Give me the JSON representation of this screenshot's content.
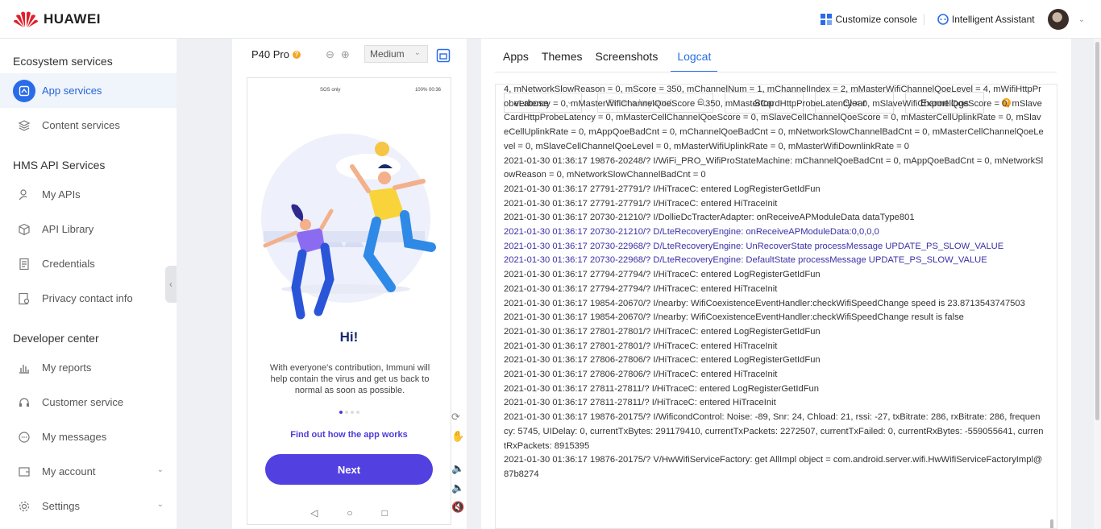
{
  "topbar": {
    "brand": "HUAWEI",
    "customize": "Customize console",
    "assistant": "Intelligent Assistant"
  },
  "sidebar": {
    "groups": [
      {
        "title": "Ecosystem services",
        "items": [
          {
            "label": "App services",
            "icon": "app-services-icon",
            "active": true
          },
          {
            "label": "Content services",
            "icon": "layers-icon"
          }
        ]
      },
      {
        "title": "HMS API Services",
        "items": [
          {
            "label": "My APIs",
            "icon": "api-user-icon"
          },
          {
            "label": "API Library",
            "icon": "cube-icon"
          },
          {
            "label": "Credentials",
            "icon": "document-icon"
          },
          {
            "label": "Privacy contact info",
            "icon": "privacy-icon"
          }
        ]
      },
      {
        "title": "Developer center",
        "items": [
          {
            "label": "My reports",
            "icon": "bar-chart-icon"
          },
          {
            "label": "Customer service",
            "icon": "headset-icon"
          },
          {
            "label": "My messages",
            "icon": "chat-icon"
          },
          {
            "label": "My account",
            "icon": "wallet-icon",
            "expandable": true
          },
          {
            "label": "Settings",
            "icon": "gear-icon",
            "expandable": true
          }
        ]
      }
    ]
  },
  "device": {
    "name": "P40 Pro",
    "zoom_select": "Medium",
    "statusbar_left": "SOS only",
    "statusbar_right": "100%  00:36",
    "screen": {
      "greeting": "Hi!",
      "description": "With everyone's contribution, Immuni will help contain the virus and get us back to normal as soon as possible.",
      "link": "Find out how the app works",
      "next_button": "Next"
    }
  },
  "logcat": {
    "tabs": [
      "Apps",
      "Themes",
      "Screenshots",
      "Logcat"
    ],
    "active_tab": "Logcat",
    "level": "verbose",
    "search_placeholder": "Enter a keyword.",
    "buttons": {
      "stop": "Stop",
      "clear": "Clear",
      "export": "Export logs"
    },
    "lines": [
      {
        "text": "4, mNetworkSlowReason = 0, mScore = 350, mChannelNum = 1, mChannelIndex = 2, mMasterWifiChannelQoeLevel = 4, mWifiHttpProbeLatency = 0, mMasterWifiChannelQoeScore = 350, mMasterCardHttpProbeLatency = 0, mSlaveWifiChannelQoeScore = 0, mSlaveCardHttpProbeLatency = 0, mMasterCellChannelQoeScore = 0, mSlaveCellChannelQoeScore = 0, mMasterCellUplinkRate = 0, mSlaveCellUplinkRate = 0, mAppQoeBadCnt = 0, mChannelQoeBadCnt = 0, mNetworkSlowChannelBadCnt = 0, mMasterCellChannelQoeLevel = 0, mSlaveCellChannelQoeLevel = 0, mMasterWifiUplinkRate = 0, mMasterWifiDownlinkRate = 0",
        "level": "i"
      },
      {
        "text": "2021-01-30 01:36:17 19876-20248/? I/WiFi_PRO_WifiProStateMachine: mChannelQoeBadCnt = 0, mAppQoeBadCnt = 0, mNetworkSlowReason = 0, mNetworkSlowChannelBadCnt = 0",
        "level": "i"
      },
      {
        "text": "2021-01-30 01:36:17 27791-27791/? I/HiTraceC: entered LogRegisterGetIdFun",
        "level": "i"
      },
      {
        "text": "2021-01-30 01:36:17 27791-27791/? I/HiTraceC: entered HiTraceInit",
        "level": "i"
      },
      {
        "text": "2021-01-30 01:36:17 20730-21210/? I/DollieDcTracterAdapter: onReceiveAPModuleData dataType801",
        "level": "i"
      },
      {
        "text": "2021-01-30 01:36:17 20730-21210/? D/LteRecoveryEngine: onReceiveAPModuleData:0,0,0,0",
        "level": "d"
      },
      {
        "text": "2021-01-30 01:36:17 20730-22968/? D/LteRecoveryEngine: UnRecoverState processMessage UPDATE_PS_SLOW_VALUE",
        "level": "d"
      },
      {
        "text": "2021-01-30 01:36:17 20730-22968/? D/LteRecoveryEngine: DefaultState processMessage UPDATE_PS_SLOW_VALUE",
        "level": "d"
      },
      {
        "text": "2021-01-30 01:36:17 27794-27794/? I/HiTraceC: entered LogRegisterGetIdFun",
        "level": "i"
      },
      {
        "text": "2021-01-30 01:36:17 27794-27794/? I/HiTraceC: entered HiTraceInit",
        "level": "i"
      },
      {
        "text": "2021-01-30 01:36:17 19854-20670/? I/nearby: WifiCoexistenceEventHandler:checkWifiSpeedChange speed is 23.8713543747503",
        "level": "i"
      },
      {
        "text": "2021-01-30 01:36:17 19854-20670/? I/nearby: WifiCoexistenceEventHandler:checkWifiSpeedChange result is false",
        "level": "i"
      },
      {
        "text": "2021-01-30 01:36:17 27801-27801/? I/HiTraceC: entered LogRegisterGetIdFun",
        "level": "i"
      },
      {
        "text": "2021-01-30 01:36:17 27801-27801/? I/HiTraceC: entered HiTraceInit",
        "level": "i"
      },
      {
        "text": "2021-01-30 01:36:17 27806-27806/? I/HiTraceC: entered LogRegisterGetIdFun",
        "level": "i"
      },
      {
        "text": "2021-01-30 01:36:17 27806-27806/? I/HiTraceC: entered HiTraceInit",
        "level": "i"
      },
      {
        "text": "2021-01-30 01:36:17 27811-27811/? I/HiTraceC: entered LogRegisterGetIdFun",
        "level": "i"
      },
      {
        "text": "2021-01-30 01:36:17 27811-27811/? I/HiTraceC: entered HiTraceInit",
        "level": "i"
      },
      {
        "text": "2021-01-30 01:36:17 19876-20175/? I/WificondControl: Noise: -89, Snr: 24, Chload: 21, rssi: -27, txBitrate: 286, rxBitrate: 286, frequency: 5745, UIDelay: 0, currentTxBytes: 291179410, currentTxPackets: 2272507, currentTxFailed: 0, currentRxBytes: -559055641, currentRxPackets: 8915395",
        "level": "i"
      },
      {
        "text": "2021-01-30 01:36:17 19876-20175/? V/HwWifiServiceFactory: get AllImpl object = com.android.server.wifi.HwWifiServiceFactoryImpl@87b8274",
        "level": "v"
      }
    ]
  }
}
